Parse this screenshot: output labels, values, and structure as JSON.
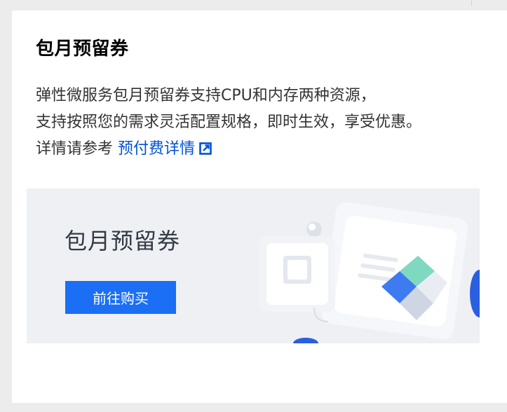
{
  "card": {
    "title": "包月预留券",
    "description_lines": [
      "弹性微服务包月预留券支持CPU和内存两种资源，",
      "支持按照您的需求灵活配置规格，即时生效，享受优惠。"
    ],
    "details_prefix": "详情请参考 ",
    "details_link": "预付费详情",
    "link_icon": "external-link-icon"
  },
  "banner": {
    "title": "包月预留券",
    "button_label": "前往购买",
    "illustration_icon": "voucher-illustration"
  },
  "colors": {
    "accent": "#1b6ff5",
    "link": "#0052d9",
    "banner_bg": "#eef0f4"
  }
}
